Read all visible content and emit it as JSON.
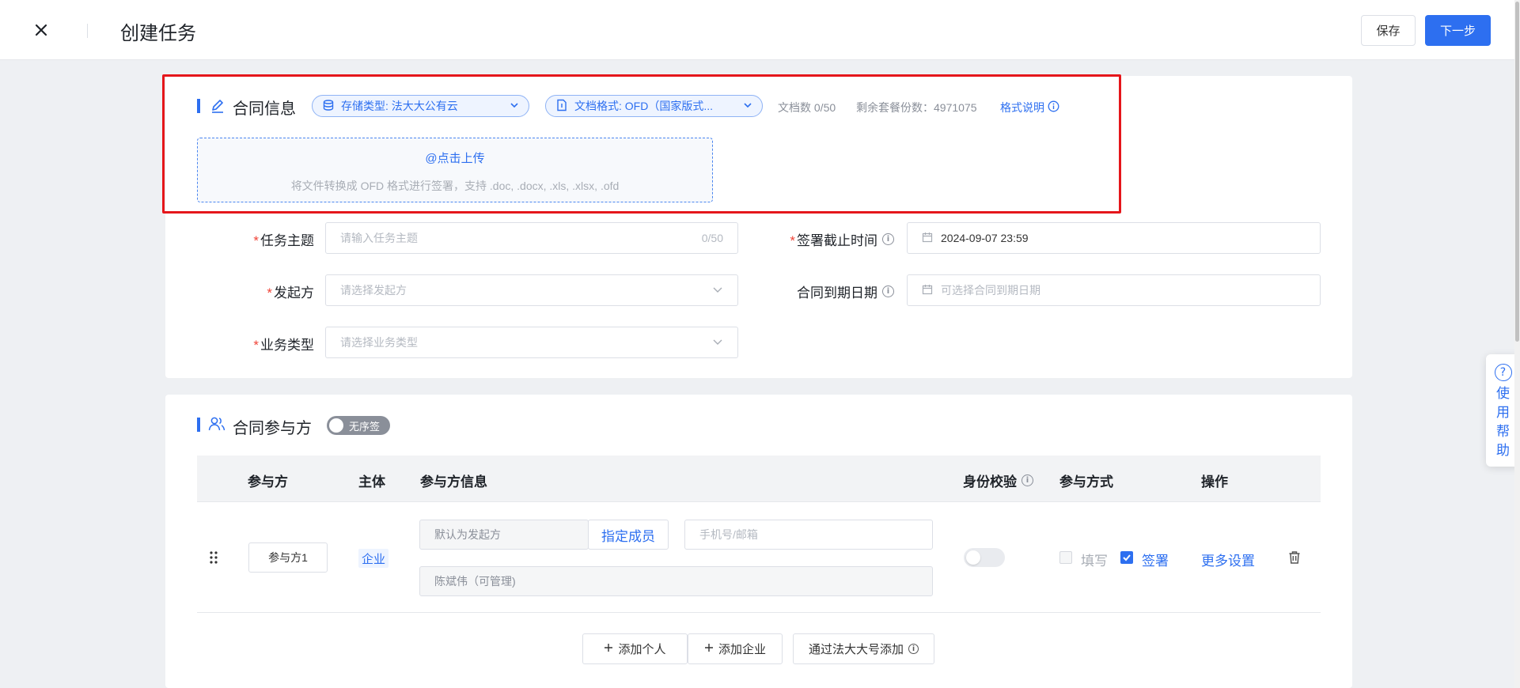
{
  "header": {
    "title": "创建任务",
    "save_label": "保存",
    "next_label": "下一步"
  },
  "contract_info": {
    "title": "合同信息",
    "storage_pill": "存储类型: 法大大公有云",
    "format_pill": "文档格式: OFD（国家版式...",
    "doc_count": "文档数 0/50",
    "remaining": "剩余套餐份数：4971075",
    "format_help": "格式说明",
    "upload_link": "@点击上传",
    "upload_hint": "将文件转换成 OFD 格式进行签署，支持 .doc, .docx, .xls, .xlsx, .ofd"
  },
  "form": {
    "subject_label": "任务主题",
    "subject_placeholder": "请输入任务主题",
    "subject_counter": "0/50",
    "deadline_label": "签署截止时间",
    "deadline_value": "2024-09-07 23:59",
    "initiator_label": "发起方",
    "initiator_placeholder": "请选择发起方",
    "expiry_label": "合同到期日期",
    "expiry_placeholder": "可选择合同到期日期",
    "biz_label": "业务类型",
    "biz_placeholder": "请选择业务类型"
  },
  "participants": {
    "title": "合同参与方",
    "toggle_label": "无序签",
    "columns": [
      "参与方",
      "主体",
      "参与方信息",
      "身份校验",
      "参与方式",
      "操作"
    ],
    "row": {
      "name": "参与方1",
      "entity": "企业",
      "default_initiator": "默认为发起方",
      "assign_member": "指定成员",
      "contact_placeholder": "手机号/邮箱",
      "member": "陈斌伟（可管理)",
      "fill_label": "填写",
      "sign_label": "签署",
      "more_settings": "更多设置"
    },
    "add_person": "添加个人",
    "add_company": "添加企业",
    "add_by_account": "通过法大大号添加"
  },
  "help": {
    "label": "使用帮助"
  },
  "colors": {
    "primary": "#2d6ff0",
    "highlight": "#e5161b"
  }
}
